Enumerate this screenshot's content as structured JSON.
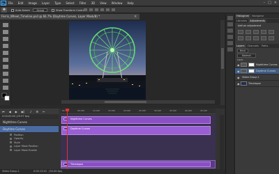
{
  "app": {
    "logo": "Ps"
  },
  "menu": [
    "File",
    "Edit",
    "Image",
    "Layer",
    "Type",
    "Select",
    "Filter",
    "3D",
    "View",
    "Window",
    "Help"
  ],
  "window_controls": [
    "–",
    "□",
    "✕"
  ],
  "options_bar": {
    "auto_select_label": "Auto-Select:",
    "auto_select_value": "Group",
    "show_transform": "Show Transform Controls"
  },
  "document": {
    "tab_title": "Ferris_Wheel_Timeline.psd @ 66.7% (Daytime Curves, Layer Mask/8) *",
    "close": "×"
  },
  "right_panel": {
    "top_tabs": [
      "Histogram",
      "Navigator"
    ],
    "mid_tabs": [
      "Libraries",
      "Adjustments"
    ],
    "add_adjustment": "Add an adjustment",
    "layers_tabs": [
      "Layers",
      "Channels",
      "Paths"
    ],
    "kind_label": "Kind",
    "blend_mode": "Normal",
    "lock_label": "Lock:",
    "layers": [
      {
        "name": "Nighttime Curves",
        "selected": false
      },
      {
        "name": "Daytime Curves",
        "selected": true
      },
      {
        "name": "Video Group 1",
        "selected": false
      },
      {
        "name": "Timelapse",
        "selected": false
      }
    ]
  },
  "timeline": {
    "timecode": "0:00:00:00 (29.97 fps)",
    "ruler_ticks": [
      "00",
      "05:00f",
      "10:00f",
      "15:00f",
      "20:00f",
      "25:00f",
      "30:00f",
      "35:00f",
      "40:00f",
      "45:00f"
    ],
    "tracks": [
      {
        "name": "Nighttime Curves",
        "selected": false
      },
      {
        "name": "Daytime Curves",
        "selected": true
      }
    ],
    "properties": [
      "Position",
      "Opacity",
      "Style",
      "Layer Mask Position",
      "Layer Mask Enable"
    ],
    "clips": [
      "Nighttime Curves",
      "Daytime Curves",
      "Timelapse"
    ],
    "video_group": "Video Group 1",
    "footer_time": "0:00:13:01",
    "footer_fps": "(30.00 fps)"
  },
  "colors": {
    "accent": "#8a4fc4",
    "selection": "#4a6aa0",
    "playhead": "#dd3333"
  }
}
